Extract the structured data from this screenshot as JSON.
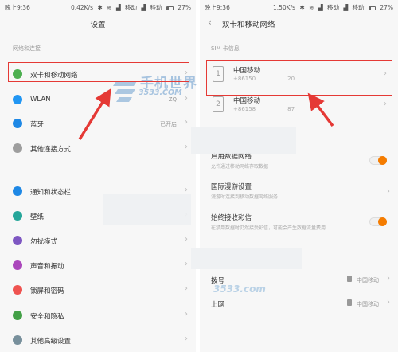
{
  "left": {
    "status": {
      "time": "晚上9:36",
      "speed": "0.42K/s",
      "carrier1": "移动",
      "carrier2": "移动",
      "battery": "27%"
    },
    "title": "设置",
    "section_header": "网络和连接",
    "items": [
      {
        "label": "双卡和移动网络",
        "value": "",
        "icon": "dual-sim-icon",
        "color": "#4caf50"
      },
      {
        "label": "WLAN",
        "value": "ZQ",
        "icon": "wifi-icon",
        "color": "#2196f3"
      },
      {
        "label": "蓝牙",
        "value": "已开启",
        "icon": "bluetooth-icon",
        "color": "#1e88e5"
      },
      {
        "label": "其他连接方式",
        "value": "",
        "icon": "link-icon",
        "color": "#9e9e9e"
      },
      {
        "label": "通知和状态栏",
        "value": "",
        "icon": "notification-icon",
        "color": "#1e88e5"
      },
      {
        "label": "壁纸",
        "value": "",
        "icon": "wallpaper-icon",
        "color": "#26a69a"
      },
      {
        "label": "勿扰模式",
        "value": "",
        "icon": "moon-icon",
        "color": "#7e57c2"
      },
      {
        "label": "声音和振动",
        "value": "",
        "icon": "sound-icon",
        "color": "#ab47bc"
      },
      {
        "label": "锁屏和密码",
        "value": "",
        "icon": "lock-icon",
        "color": "#ef5350"
      },
      {
        "label": "安全和隐私",
        "value": "",
        "icon": "shield-icon",
        "color": "#43a047"
      },
      {
        "label": "其他高级设置",
        "value": "",
        "icon": "more-icon",
        "color": "#78909c"
      }
    ]
  },
  "right": {
    "status": {
      "time": "晚上9:36",
      "speed": "1.50K/s",
      "carrier1": "移动",
      "carrier2": "移动",
      "battery": "27%"
    },
    "title": "双卡和移动网络",
    "section_header": "SIM 卡信息",
    "sims": [
      {
        "slot": "1",
        "name": "中国移动",
        "number": "+86150",
        "number_tail": "20"
      },
      {
        "slot": "2",
        "name": "中国移动",
        "number": "+86158",
        "number_tail": "87"
      }
    ],
    "settings": [
      {
        "title": "启用数据网络",
        "desc": "允许通过移动网络存取数据",
        "toggle": "on"
      },
      {
        "title": "国际漫游设置",
        "desc": "漫游时连接到移动数据网络服务",
        "toggle": ""
      },
      {
        "title": "始终接收彩信",
        "desc": "在禁用数据时仍然接受彩信，可能会产生数据流量费用",
        "toggle": "on"
      }
    ],
    "defaults": [
      {
        "title": "拨号",
        "value": "中国移动"
      },
      {
        "title": "上网",
        "value": "中国移动"
      }
    ]
  },
  "watermark": {
    "brand": "手机世界",
    "domain": "3533.COM",
    "domain_lower": "3533.com"
  },
  "colors": {
    "highlight": "#e53935",
    "toggle_on": "#f57c00",
    "watermark": "#9ebedd"
  }
}
